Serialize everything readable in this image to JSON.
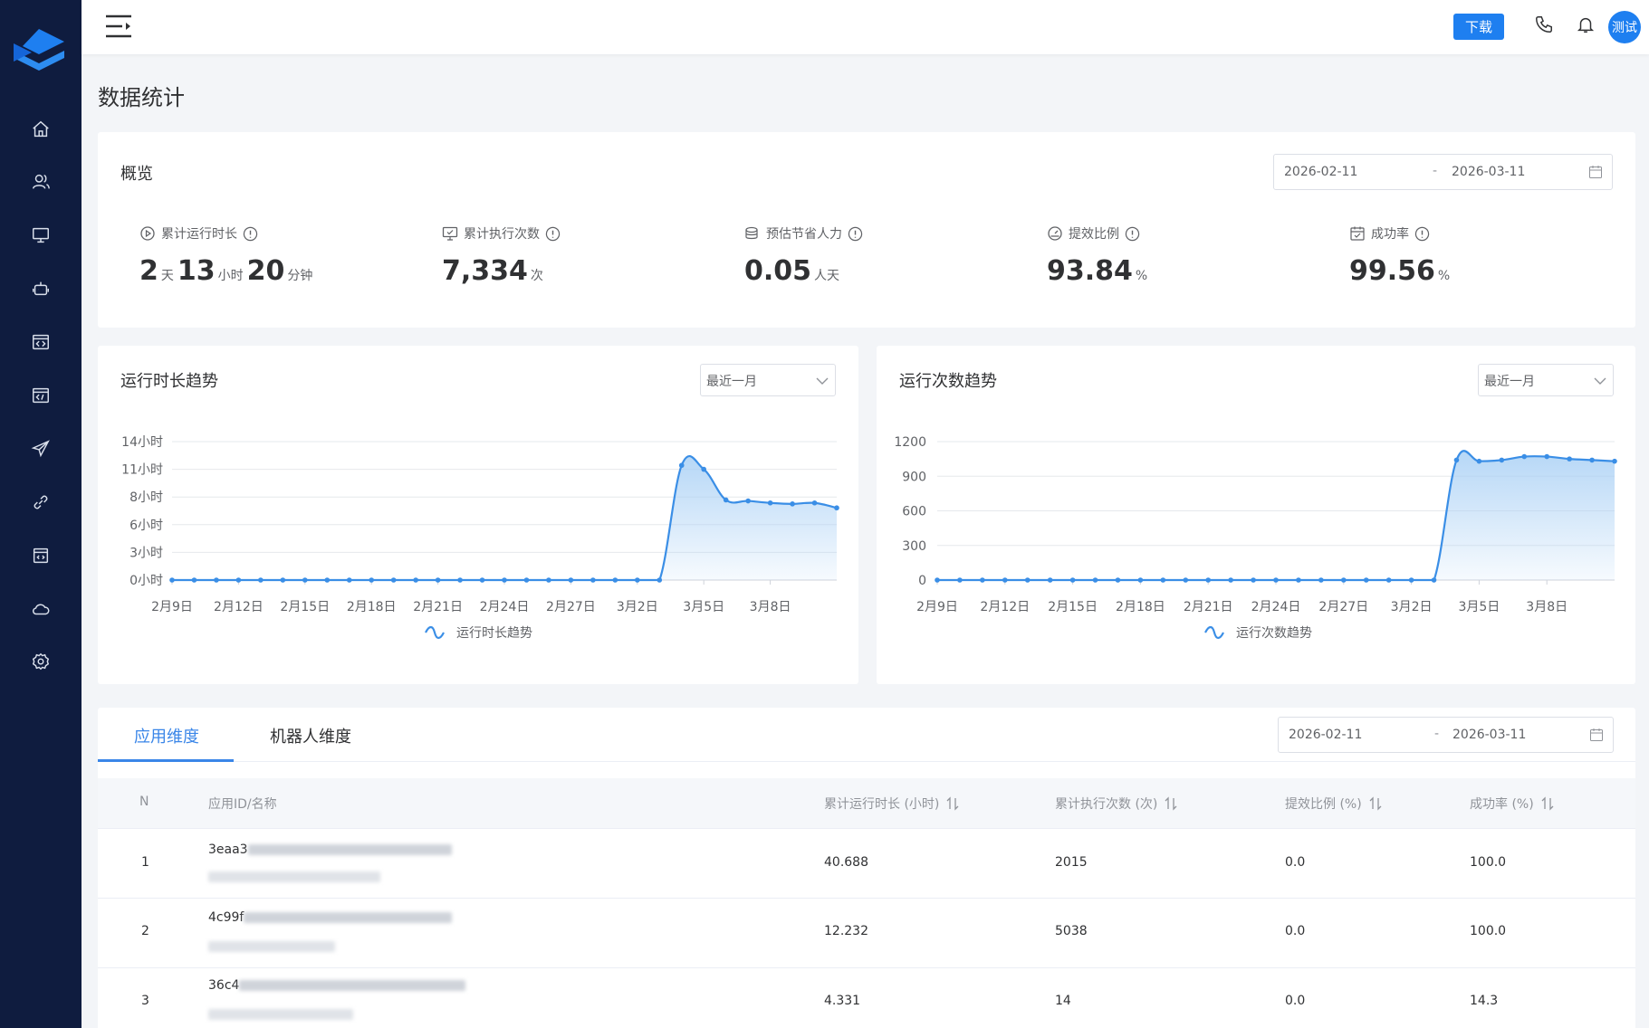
{
  "header": {
    "download_label": "下载",
    "avatar_text": "测试"
  },
  "page_title": "数据统计",
  "overview": {
    "title": "概览",
    "date_start": "2026-02-11",
    "date_sep": "-",
    "date_end": "2026-03-11",
    "kpis": [
      {
        "label": "累计运行时长",
        "icon": "play-circle-icon",
        "parts": [
          {
            "v": "2",
            "u": "天"
          },
          {
            "v": "13",
            "u": "小时"
          },
          {
            "v": "20",
            "u": "分钟"
          }
        ]
      },
      {
        "label": "累计执行次数",
        "icon": "monitor-icon",
        "value": "7,334",
        "unit": "次"
      },
      {
        "label": "预估节省人力",
        "icon": "coins-icon",
        "value": "0.05",
        "unit": "人天"
      },
      {
        "label": "提效比例",
        "icon": "gauge-icon",
        "value": "93.84",
        "unit": "%"
      },
      {
        "label": "成功率",
        "icon": "calendar-check-icon",
        "value": "99.56",
        "unit": "%"
      }
    ]
  },
  "charts": {
    "duration": {
      "title": "运行时长趋势",
      "range_select": "最近一月"
    },
    "count": {
      "title": "运行次数趋势",
      "range_select": "最近一月"
    }
  },
  "chart_data": [
    {
      "type": "area",
      "title": "运行时长趋势",
      "legend": "运行时长趋势",
      "ytick_labels": [
        "0小时",
        "3小时",
        "6小时",
        "8小时",
        "11小时",
        "14小时"
      ],
      "xtick_labels": [
        "2月9日",
        "2月12日",
        "2月15日",
        "2月18日",
        "2月21日",
        "2月24日",
        "2月27日",
        "3月2日",
        "3月5日",
        "3月8日"
      ],
      "ylim": [
        0,
        14
      ],
      "x": [
        "2月9日",
        "2月10日",
        "2月11日",
        "2月12日",
        "2月13日",
        "2月14日",
        "2月15日",
        "2月16日",
        "2月17日",
        "2月18日",
        "2月19日",
        "2月20日",
        "2月21日",
        "2月22日",
        "2月23日",
        "2月24日",
        "2月25日",
        "2月26日",
        "2月27日",
        "2月28日",
        "3月1日",
        "3月2日",
        "3月3日",
        "3月4日",
        "3月5日",
        "3月6日",
        "3月7日",
        "3月8日",
        "3月9日",
        "3月10日",
        "3月11日"
      ],
      "values": [
        0,
        0,
        0,
        0,
        0,
        0,
        0,
        0,
        0,
        0,
        0,
        0,
        0,
        0,
        0,
        0,
        0,
        0,
        0,
        0,
        0,
        0,
        0,
        11.6,
        11.2,
        8.1,
        8.0,
        7.8,
        7.7,
        7.8,
        7.3
      ],
      "grid": true,
      "legend_position": "bottom"
    },
    {
      "type": "area",
      "title": "运行次数趋势",
      "legend": "运行次数趋势",
      "ytick_labels": [
        "0",
        "300",
        "600",
        "900",
        "1200"
      ],
      "xtick_labels": [
        "2月9日",
        "2月12日",
        "2月15日",
        "2月18日",
        "2月21日",
        "2月24日",
        "2月27日",
        "3月2日",
        "3月5日",
        "3月8日"
      ],
      "ylim": [
        0,
        1200
      ],
      "x": [
        "2月9日",
        "2月10日",
        "2月11日",
        "2月12日",
        "2月13日",
        "2月14日",
        "2月15日",
        "2月16日",
        "2月17日",
        "2月18日",
        "2月19日",
        "2月20日",
        "2月21日",
        "2月22日",
        "2月23日",
        "2月24日",
        "2月25日",
        "2月26日",
        "2月27日",
        "2月28日",
        "3月1日",
        "3月2日",
        "3月3日",
        "3月4日",
        "3月5日",
        "3月6日",
        "3月7日",
        "3月8日",
        "3月9日",
        "3月10日",
        "3月11日"
      ],
      "values": [
        0,
        0,
        0,
        0,
        0,
        0,
        0,
        0,
        0,
        0,
        0,
        0,
        0,
        0,
        0,
        0,
        0,
        0,
        0,
        0,
        0,
        0,
        0,
        1040,
        1030,
        1040,
        1070,
        1070,
        1050,
        1040,
        1030
      ],
      "grid": true,
      "legend_position": "bottom"
    }
  ],
  "table_section": {
    "tabs": [
      "应用维度",
      "机器人维度"
    ],
    "active_tab": "应用维度",
    "date_start": "2026-02-11",
    "date_sep": "-",
    "date_end": "2026-03-11",
    "columns": [
      "N",
      "应用ID/名称",
      "累计运行时长 (小时)",
      "累计执行次数 (次)",
      "提效比例 (%)",
      "成功率 (%)"
    ],
    "rows": [
      {
        "n": "1",
        "id_prefix": "3eaa3",
        "duration": "40.688",
        "count": "2015",
        "ratio": "0.0",
        "success": "100.0"
      },
      {
        "n": "2",
        "id_prefix": "4c99f",
        "duration": "12.232",
        "count": "5038",
        "ratio": "0.0",
        "success": "100.0"
      },
      {
        "n": "3",
        "id_prefix": "36c4",
        "duration": "4.331",
        "count": "14",
        "ratio": "0.0",
        "success": "14.3"
      }
    ]
  },
  "colors": {
    "sidebar_bg": "#0f1c3f",
    "accent": "#1e7ff0",
    "line": "#3a8ee6",
    "area_top": "#a9d0f5"
  },
  "sidebar_icons": [
    "home-icon",
    "users-icon",
    "monitor-icon",
    "robot-icon",
    "code-window-icon",
    "code-window-icon",
    "send-icon",
    "link-icon",
    "code-file-icon",
    "cloud-icon",
    "settings-icon"
  ]
}
